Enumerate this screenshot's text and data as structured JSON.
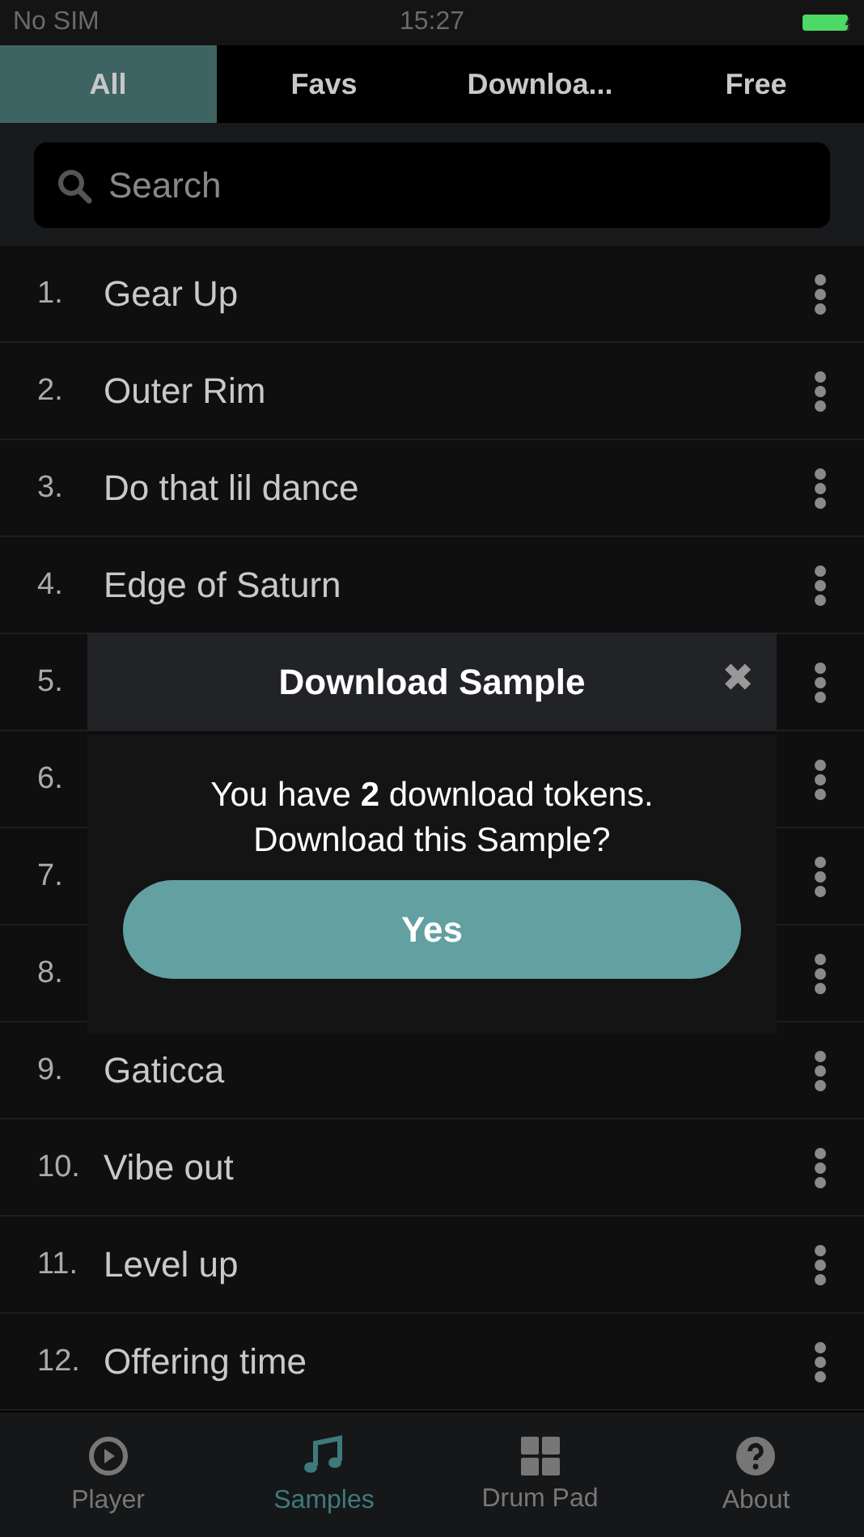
{
  "status_bar": {
    "carrier": "No SIM",
    "time": "15:27"
  },
  "tabs": [
    {
      "label": "All",
      "selected": true
    },
    {
      "label": "Favs",
      "selected": false
    },
    {
      "label": "Downloa...",
      "selected": false
    },
    {
      "label": "Free",
      "selected": false
    }
  ],
  "search": {
    "placeholder": "Search"
  },
  "samples": [
    {
      "number": "1.",
      "title": "Gear Up"
    },
    {
      "number": "2.",
      "title": "Outer Rim"
    },
    {
      "number": "3.",
      "title": "Do that lil dance"
    },
    {
      "number": "4.",
      "title": "Edge of Saturn"
    },
    {
      "number": "5."
    },
    {
      "number": "6."
    },
    {
      "number": "7."
    },
    {
      "number": "8."
    },
    {
      "number": "9.",
      "title": "Gaticca"
    },
    {
      "number": "10.",
      "title": "Vibe out"
    },
    {
      "number": "11.",
      "title": "Level up"
    },
    {
      "number": "12.",
      "title": "Offering time"
    }
  ],
  "dialog": {
    "title": "Download Sample",
    "close": "✖",
    "message": "You have **2** download tokens.\nDownload this Sample?",
    "button": "Yes"
  },
  "bottom_nav": [
    {
      "kind": "player",
      "label": "Player",
      "selected": false
    },
    {
      "kind": "samples",
      "label": "Samples",
      "selected": true
    },
    {
      "kind": "drumpad",
      "label": "Drum Pad",
      "selected": false
    },
    {
      "kind": "about",
      "label": "About",
      "selected": false
    }
  ]
}
